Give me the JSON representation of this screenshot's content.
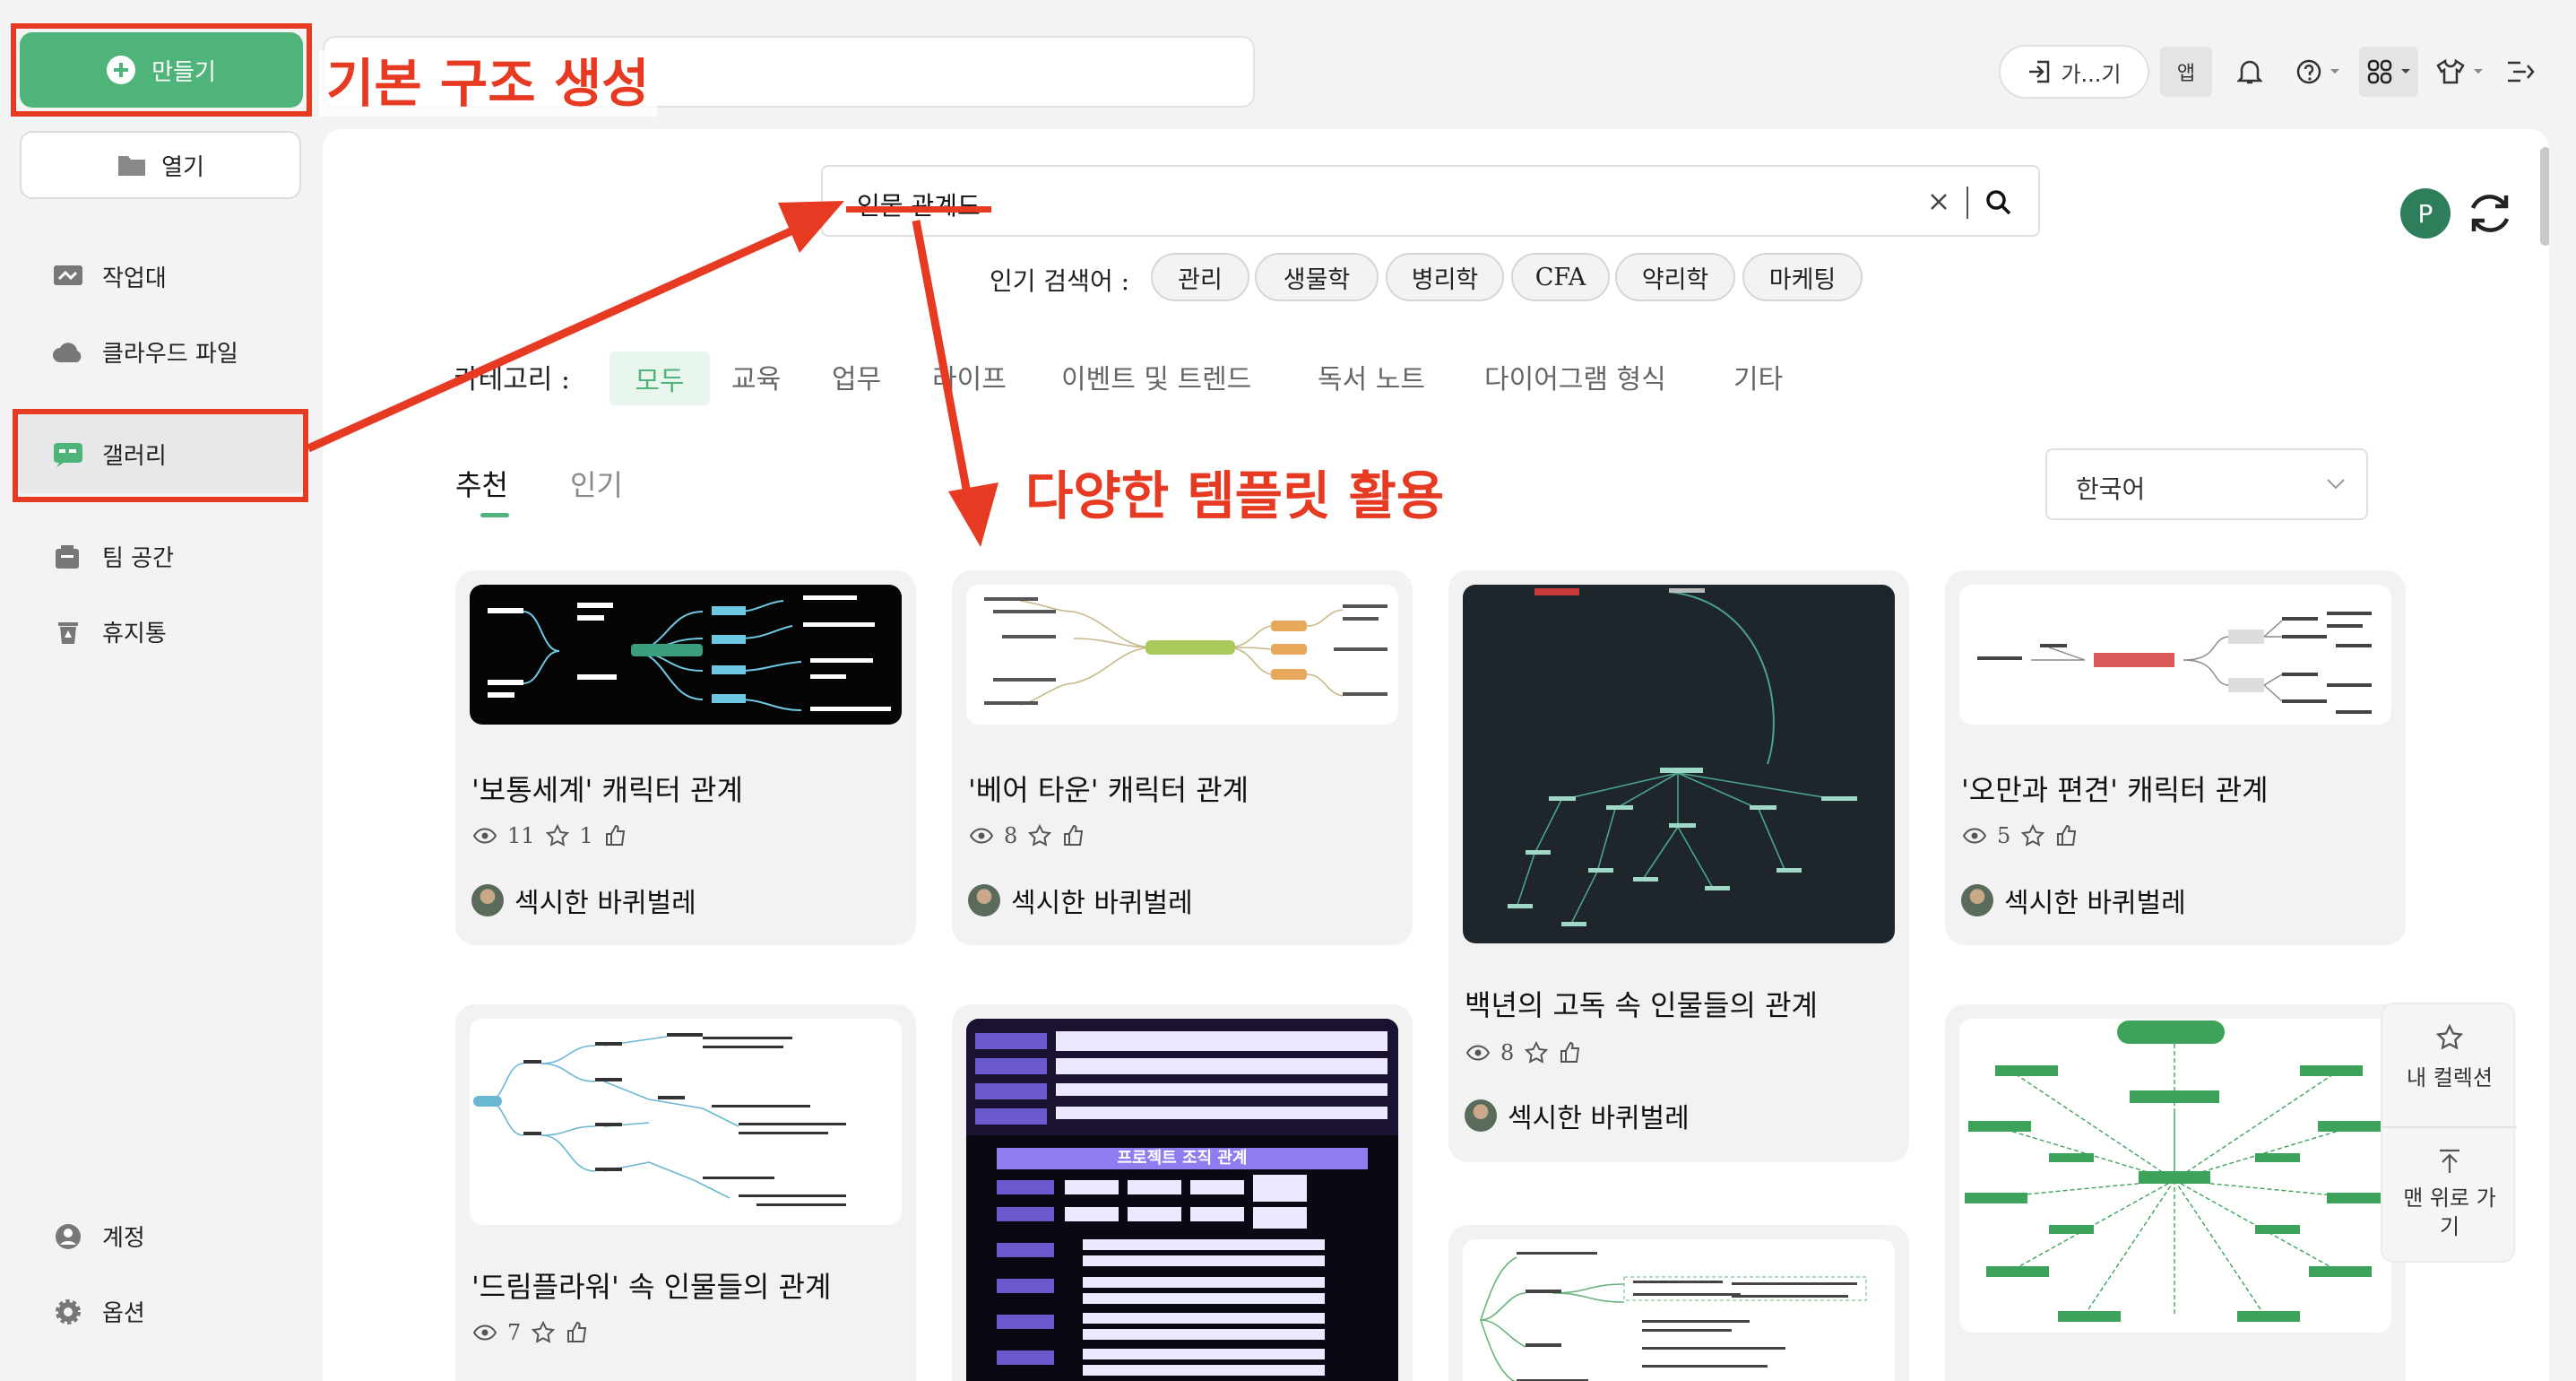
{
  "sidebar": {
    "create_label": "만들기",
    "open_label": "열기",
    "items": [
      {
        "label": "작업대"
      },
      {
        "label": "클라우드 파일"
      },
      {
        "label": "갤러리"
      },
      {
        "label": "팀 공간"
      },
      {
        "label": "휴지통"
      }
    ],
    "bottom": [
      {
        "label": "계정"
      },
      {
        "label": "옵션"
      }
    ]
  },
  "topbar": {
    "login_label": "가...기",
    "app_label": "앱"
  },
  "search": {
    "value": "인물 관계도",
    "hot_label": "인기 검색어 :",
    "hot_terms": [
      "관리",
      "생물학",
      "병리학",
      "CFA",
      "약리학",
      "마케팅"
    ]
  },
  "categories": {
    "label": "카테고리 :",
    "items": [
      "모두",
      "교육",
      "업무",
      "라이프",
      "이벤트 및 트렌드",
      "독서 노트",
      "다이어그램 형식",
      "기타"
    ]
  },
  "tabs": [
    "추천",
    "인기"
  ],
  "language": "한국어",
  "user_initial": "P",
  "cards": [
    {
      "title": "'보통세계' 캐릭터 관계",
      "views": "11",
      "stars": "1",
      "author": "섹시한 바퀴벌레"
    },
    {
      "title": "'베어 타운' 캐릭터 관계",
      "views": "8",
      "stars": "",
      "author": "섹시한 바퀴벌레"
    },
    {
      "title": "백년의 고독 속 인물들의 관계",
      "views": "8",
      "stars": "",
      "author": "섹시한 바퀴벌레"
    },
    {
      "title": "'오만과 편견' 캐릭터 관계",
      "views": "5",
      "stars": "",
      "author": "섹시한 바퀴벌레"
    },
    {
      "title": "'드림플라워' 속 인물들의 관계",
      "views": "7",
      "stars": "",
      "author": ""
    },
    {
      "thumb_heading": "프로젝트 조직 관계"
    }
  ],
  "float_panel": {
    "collection_label": "내 컬렉션",
    "top_label_1": "맨 위로 가",
    "top_label_2": "기"
  },
  "annotations": {
    "a1": "기본 구조 생성",
    "a2": "다양한 템플릿 활용"
  },
  "colors": {
    "brand_green": "#4fb479",
    "annotation_red": "#e63a22"
  }
}
